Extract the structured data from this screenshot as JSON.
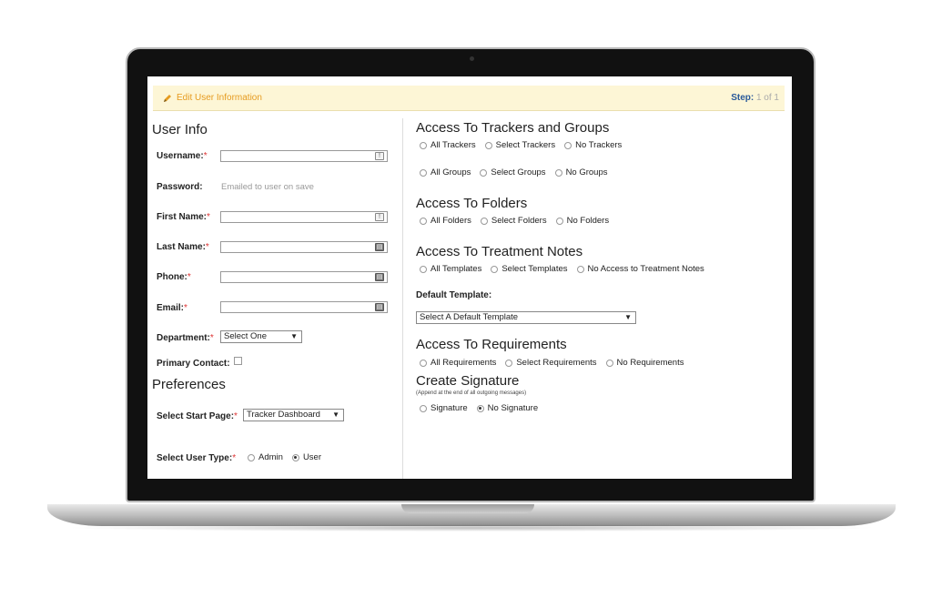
{
  "header": {
    "title": "Edit User Information",
    "step_label": "Step:",
    "step_value": "1 of 1"
  },
  "user_info": {
    "title": "User Info",
    "username_label": "Username:",
    "password_label": "Password:",
    "password_value": "Emailed to user on save",
    "first_name_label": "First Name:",
    "last_name_label": "Last Name:",
    "phone_label": "Phone:",
    "email_label": "Email:",
    "department_label": "Department:",
    "department_value": "Select One",
    "primary_contact_label": "Primary Contact:",
    "required_mark": "*"
  },
  "preferences": {
    "title": "Preferences",
    "start_page_label": "Select Start Page:",
    "start_page_value": "Tracker Dashboard",
    "user_type_label": "Select User Type:",
    "user_type_options": [
      "Admin",
      "User"
    ],
    "user_type_selected": "User"
  },
  "trackers": {
    "title": "Access To Trackers and Groups",
    "tracker_options": [
      "All Trackers",
      "Select Trackers",
      "No Trackers"
    ],
    "group_options": [
      "All Groups",
      "Select Groups",
      "No Groups"
    ]
  },
  "folders": {
    "title": "Access To Folders",
    "options": [
      "All Folders",
      "Select Folders",
      "No Folders"
    ]
  },
  "treatment_notes": {
    "title": "Access To Treatment Notes",
    "options": [
      "All Templates",
      "Select Templates",
      "No Access to Treatment Notes"
    ],
    "default_template_label": "Default Template:",
    "default_template_value": "Select A Default Template"
  },
  "requirements": {
    "title": "Access To Requirements",
    "options": [
      "All Requirements",
      "Select Requirements",
      "No Requirements"
    ]
  },
  "signature": {
    "title": "Create Signature",
    "note": "(Append at the end of all outgoing messages)",
    "options": [
      "Signature",
      "No Signature"
    ],
    "selected": "No Signature"
  },
  "icons": {
    "select_arrow": "▼",
    "info_glyph": "!",
    "card_glyph": "▤"
  },
  "colors": {
    "header_bg": "#fdf6d6",
    "header_title": "#e69b1f",
    "step_label": "#2a5a9a",
    "required": "#dd3333"
  }
}
